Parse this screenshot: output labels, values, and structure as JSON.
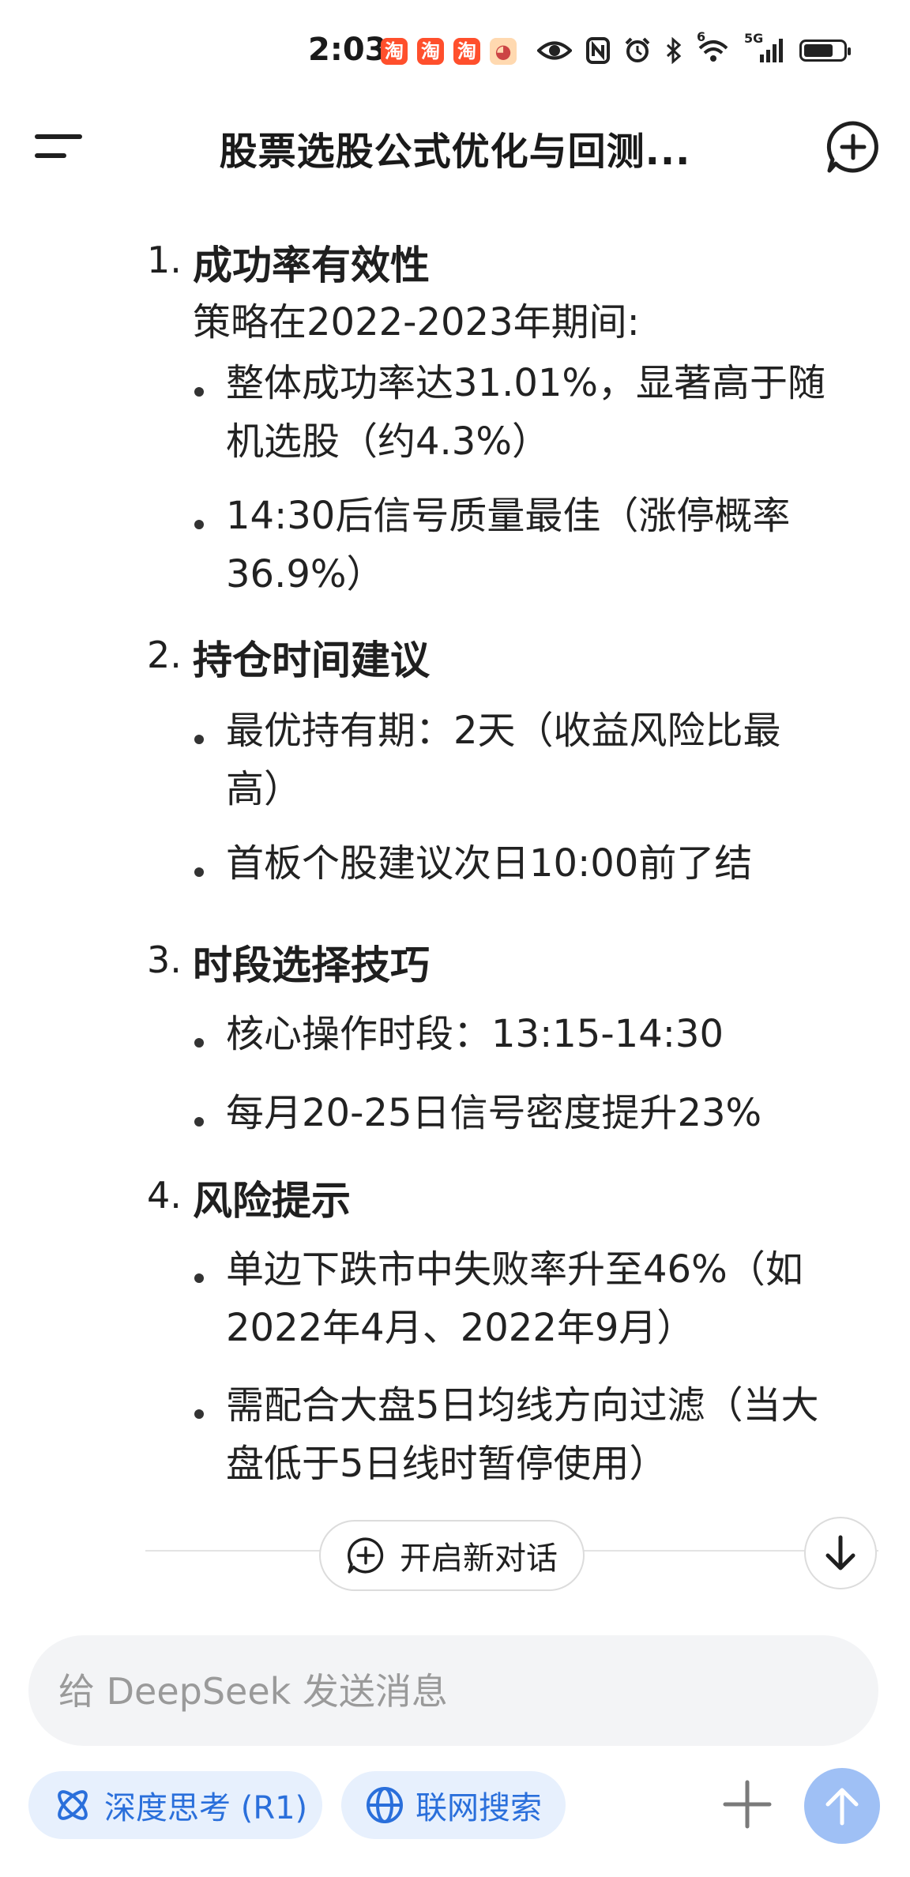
{
  "status_bar": {
    "time": "2:03",
    "app_icons": [
      "淘",
      "淘",
      "淘"
    ],
    "icons": [
      "eye-icon",
      "nfc-icon",
      "alarm-icon",
      "bluetooth-icon",
      "wifi-icon",
      "signal-5g-icon",
      "battery-icon"
    ],
    "wifi_badge": "6",
    "network_badge": "5G",
    "battery_level": 0.75
  },
  "header": {
    "title": "股票选股公式优化与回测..."
  },
  "content": {
    "sections": [
      {
        "number": "1.",
        "title": "成功率有效性",
        "paragraph": "策略在2022-2023年期间:",
        "bullets": [
          [
            "整体成功率达31.01%，显著高于随",
            "机选股（约4.3%）"
          ],
          [
            "14:30后信号质量最佳（涨停概率",
            "36.9%）"
          ]
        ]
      },
      {
        "number": "2.",
        "title": "持仓时间建议",
        "bullets": [
          [
            "最优持有期：2天（收益风险比最",
            "高）"
          ],
          [
            "首板个股建议次日10:00前了结"
          ]
        ]
      },
      {
        "number": "3.",
        "title": "时段选择技巧",
        "bullets": [
          [
            "核心操作时段：13:15-14:30"
          ],
          [
            "每月20-25日信号密度提升23%"
          ]
        ]
      },
      {
        "number": "4.",
        "title": "风险提示",
        "bullets": [
          [
            "单边下跌市中失败率升至46%（如",
            "2022年4月、2022年9月）"
          ],
          [
            "需配合大盘5日均线方向过滤（当大",
            "盘低于5日线时暂停使用）"
          ]
        ]
      }
    ]
  },
  "floating": {
    "new_dialog_label": "开启新对话"
  },
  "composer": {
    "placeholder": "给 DeepSeek 发送消息",
    "deep_think_label": "深度思考 (R1)",
    "web_search_label": "联网搜索"
  },
  "colors": {
    "accent": "#2a6fdb",
    "pill_bg": "#e7f0fd",
    "send_disabled": "#9fc0f5",
    "input_bg": "#f3f4f6"
  }
}
